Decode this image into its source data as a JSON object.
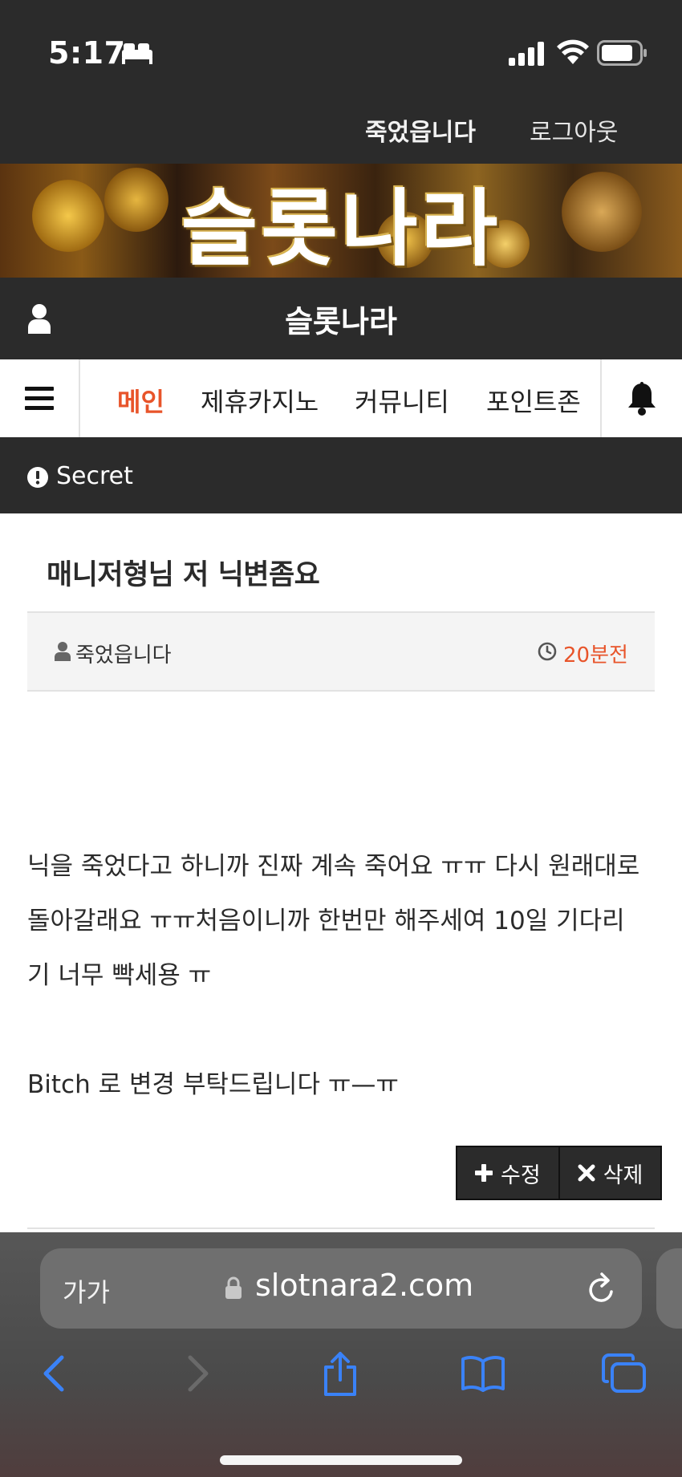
{
  "status_bar": {
    "time": "5:17"
  },
  "account": {
    "username": "죽었읍니다",
    "logout_label": "로그아웃"
  },
  "banner": {
    "title": "슬롯나라"
  },
  "site": {
    "title": "슬롯나라"
  },
  "nav": {
    "items": [
      {
        "label": "메인",
        "active": true
      },
      {
        "label": "제휴카지노",
        "active": false
      },
      {
        "label": "커뮤니티",
        "active": false
      },
      {
        "label": "포인트존",
        "active": false
      }
    ]
  },
  "section": {
    "title": "Secret"
  },
  "post": {
    "title": "매니저형님 저 닉변좀요",
    "author": "죽었읍니다",
    "time": "20분전",
    "body_line1": "닉을 죽었다고 하니까 진짜 계속 죽어요 ㅠㅠ 다시 원래대로",
    "body_line2": "돌아갈래요 ㅠㅠ처음이니까 한번만 해주세여 10일 기다리",
    "body_line3": "기 너무 빡세용 ㅠ",
    "body_line4": "Bitch 로 변경 부탁드립니다 ㅠ—ㅠ",
    "edit_label": "수정",
    "delete_label": "삭제"
  },
  "browser": {
    "aa_label": "가가",
    "url": "slotnara2.com"
  },
  "colors": {
    "dark_bar": "#2b2b2b",
    "accent": "#e8542a",
    "ios_blue": "#3a82f7"
  }
}
